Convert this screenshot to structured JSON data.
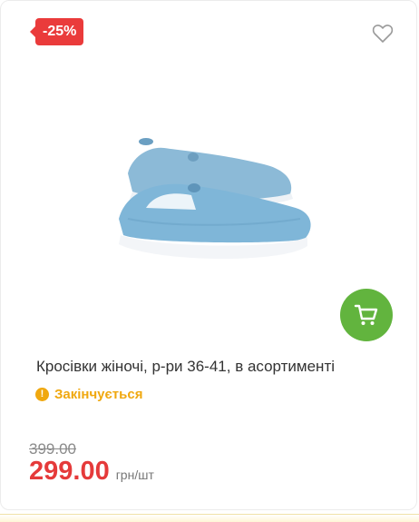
{
  "badge": {
    "discount": "-25%"
  },
  "product": {
    "title": "Кросівки жіночі, р-ри 36-41, в асортименті",
    "stock_status": "Закінчується",
    "old_price": "399.00",
    "price": "299.00",
    "unit": "грн/шт"
  },
  "icons": {
    "favorite": "heart-outline-icon",
    "cart": "cart-icon",
    "warning": "exclamation-icon"
  },
  "colors": {
    "badge": "#ea3b3b",
    "cart_button": "#62b43e",
    "stock_status": "#f0a80f",
    "price": "#e53a3a"
  }
}
